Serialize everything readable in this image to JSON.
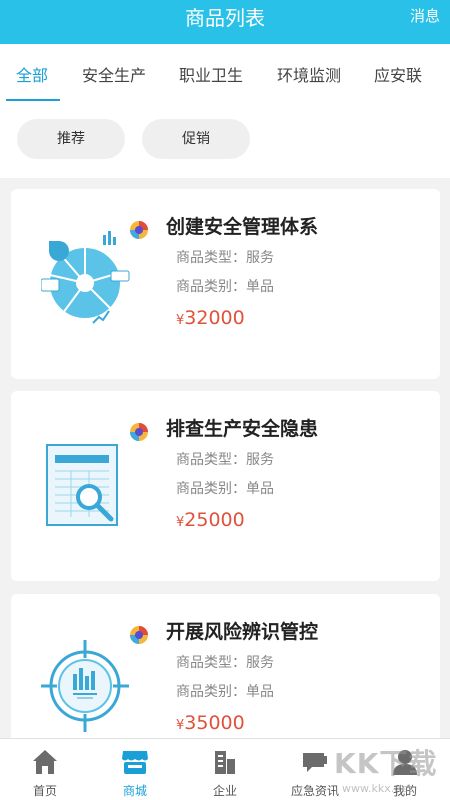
{
  "header": {
    "title": "商品列表",
    "messages_label": "消息"
  },
  "category_tabs": [
    {
      "label": "全部",
      "active": true
    },
    {
      "label": "安全生产",
      "active": false
    },
    {
      "label": "职业卫生",
      "active": false
    },
    {
      "label": "环境监测",
      "active": false
    },
    {
      "label": "应安联",
      "active": false
    }
  ],
  "filters": [
    {
      "label": "推荐"
    },
    {
      "label": "促销"
    }
  ],
  "products": [
    {
      "title": "创建安全管理体系",
      "type_line": "商品类型：服务",
      "category_line": "商品类别：单品",
      "currency": "¥",
      "price": "32000",
      "thumb_icon": "pie-chart-icon"
    },
    {
      "title": "排查生产安全隐患",
      "type_line": "商品类型：服务",
      "category_line": "商品类别：单品",
      "currency": "¥",
      "price": "25000",
      "thumb_icon": "document-magnifier-icon"
    },
    {
      "title": "开展风险辨识管控",
      "type_line": "商品类型：服务",
      "category_line": "商品类别：单品",
      "currency": "¥",
      "price": "35000",
      "thumb_icon": "target-chart-icon"
    }
  ],
  "bottom_nav": [
    {
      "label": "首页",
      "icon": "home-icon",
      "active": false
    },
    {
      "label": "商城",
      "icon": "store-icon",
      "active": true
    },
    {
      "label": "企业",
      "icon": "building-icon",
      "active": false
    },
    {
      "label": "应急资讯",
      "icon": "chat-icon",
      "active": false
    },
    {
      "label": "我的",
      "icon": "user-icon",
      "active": false
    }
  ],
  "watermark": {
    "text": "KK下载",
    "url": "www.kkx.net"
  },
  "colors": {
    "header": "#29c1e8",
    "accent": "#1a9fd6",
    "price": "#e0523c"
  }
}
